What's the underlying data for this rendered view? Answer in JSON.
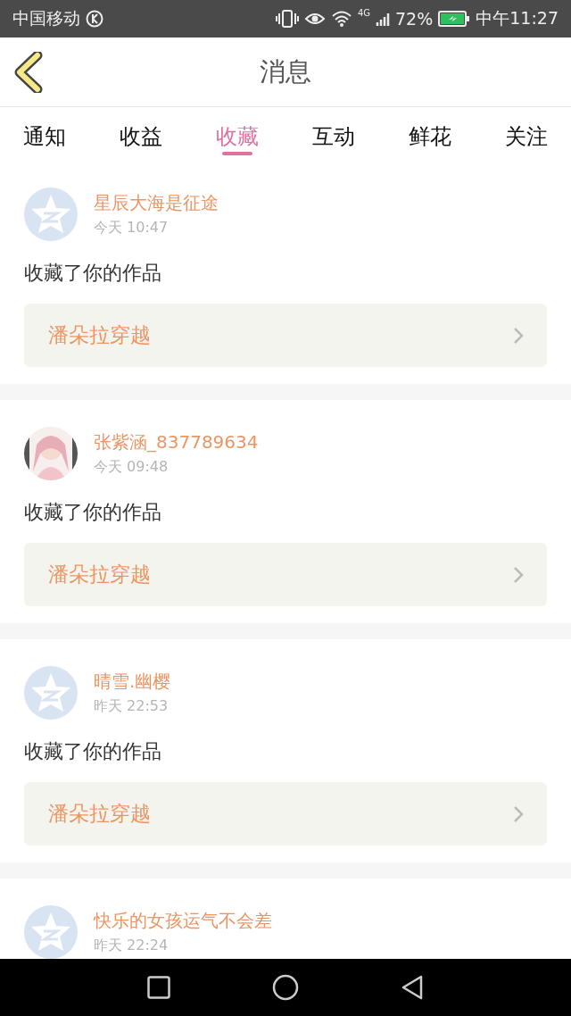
{
  "status_bar": {
    "carrier": "中国移动",
    "battery": "72%",
    "network": "4G",
    "time": "中午11:27"
  },
  "header": {
    "title": "消息"
  },
  "tabs": [
    {
      "label": "通知",
      "selected": false
    },
    {
      "label": "收益",
      "selected": false
    },
    {
      "label": "收藏",
      "selected": true
    },
    {
      "label": "互动",
      "selected": false
    },
    {
      "label": "鲜花",
      "selected": false
    },
    {
      "label": "关注",
      "selected": false
    }
  ],
  "messages": [
    {
      "avatar": {
        "kind": "default"
      },
      "name": "星辰大海是征途",
      "time": "今天 10:47",
      "action": "收藏了你的作品",
      "work": "潘朵拉穿越"
    },
    {
      "name": "张紫涵_837789634",
      "time": "今天 09:48",
      "action": "收藏了你的作品",
      "work": "潘朵拉穿越"
    },
    {
      "avatar": {
        "kind": "default"
      },
      "name": "晴雪.幽樱",
      "time": "昨天 22:53",
      "action": "收藏了你的作品",
      "work": "潘朵拉穿越"
    },
    {
      "avatar": {
        "kind": "default"
      },
      "name": "快乐的女孩运气不会差",
      "time": "昨天 22:24"
    }
  ]
}
